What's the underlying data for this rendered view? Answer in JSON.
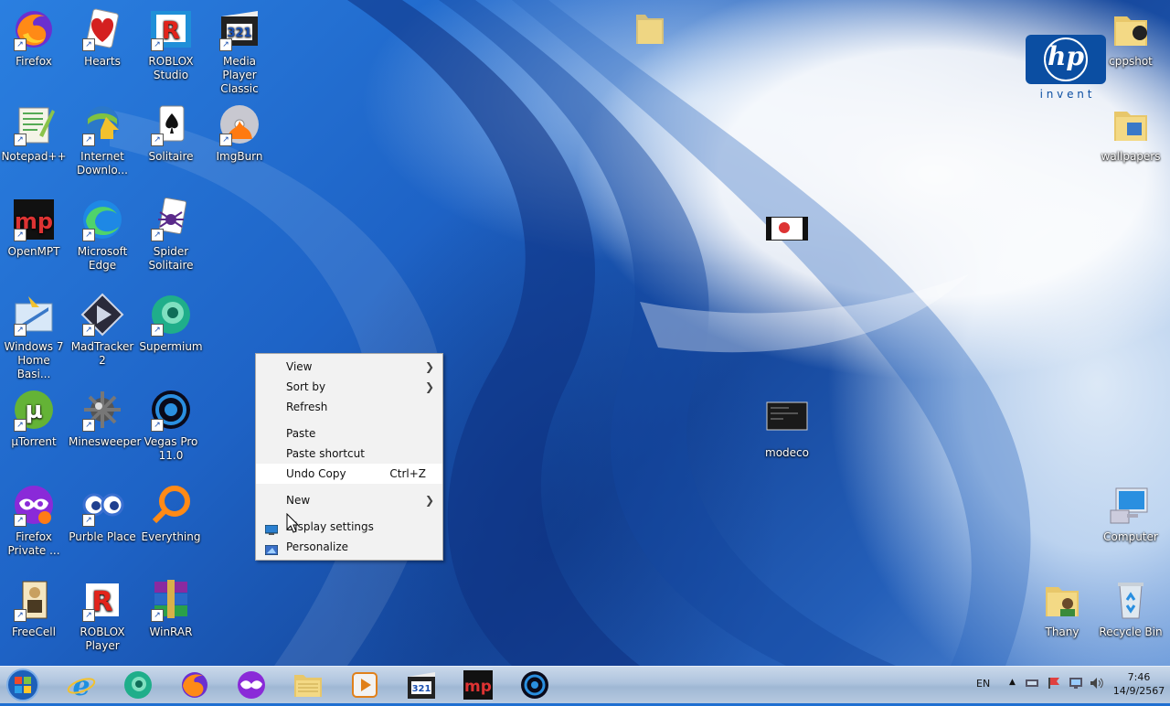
{
  "desktop_icons": [
    {
      "id": "firefox",
      "label": "Firefox"
    },
    {
      "id": "hearts",
      "label": "Hearts"
    },
    {
      "id": "roblox-studio",
      "label": "ROBLOX Studio"
    },
    {
      "id": "mpc",
      "label": "Media Player Classic"
    },
    {
      "id": "notepadpp",
      "label": "Notepad++"
    },
    {
      "id": "idm",
      "label": "Internet Downlo..."
    },
    {
      "id": "solitaire",
      "label": "Solitaire"
    },
    {
      "id": "imgburn",
      "label": "ImgBurn"
    },
    {
      "id": "openmpt",
      "label": "OpenMPT"
    },
    {
      "id": "edge",
      "label": "Microsoft Edge"
    },
    {
      "id": "spider",
      "label": "Spider Solitaire"
    },
    {
      "id": "win7",
      "label": "Windows 7 Home Basi..."
    },
    {
      "id": "madtracker",
      "label": "MadTracker 2"
    },
    {
      "id": "supermium",
      "label": "Supermium"
    },
    {
      "id": "utorrent",
      "label": "µTorrent"
    },
    {
      "id": "minesweeper",
      "label": "Minesweeper"
    },
    {
      "id": "vegas",
      "label": "Vegas Pro 11.0"
    },
    {
      "id": "ffprivate",
      "label": "Firefox Private ..."
    },
    {
      "id": "purble",
      "label": "Purble Place"
    },
    {
      "id": "everything",
      "label": "Everything"
    },
    {
      "id": "freecell",
      "label": "FreeCell"
    },
    {
      "id": "roblox-player",
      "label": "ROBLOX Player"
    },
    {
      "id": "winrar",
      "label": "WinRAR"
    },
    {
      "id": "cppshot",
      "label": "cppshot"
    },
    {
      "id": "wallpapers",
      "label": "wallpapers"
    },
    {
      "id": "modeco",
      "label": "modeco"
    },
    {
      "id": "computer",
      "label": "Computer"
    },
    {
      "id": "thany",
      "label": "Thany"
    },
    {
      "id": "recycle",
      "label": "Recycle Bin"
    }
  ],
  "logo": {
    "brand": "hp",
    "tagline": "i n v e n t"
  },
  "context_menu": {
    "items": [
      {
        "label": "View",
        "submenu": true
      },
      {
        "label": "Sort by",
        "submenu": true
      },
      {
        "label": "Refresh"
      },
      {
        "label": "Paste"
      },
      {
        "label": "Paste shortcut"
      },
      {
        "label": "Undo Copy",
        "accel": "Ctrl+Z"
      },
      {
        "label": "New",
        "submenu": true
      },
      {
        "label": "Display settings",
        "icon": "display-icon"
      },
      {
        "label": "Personalize",
        "icon": "personalize-icon"
      }
    ],
    "arrow": "❯"
  },
  "tray": {
    "language": "EN",
    "time": "7:46",
    "date": "14/9/2567"
  },
  "colors": {
    "accent": "#1f6fd1",
    "hp_blue": "#0b4ea2"
  }
}
